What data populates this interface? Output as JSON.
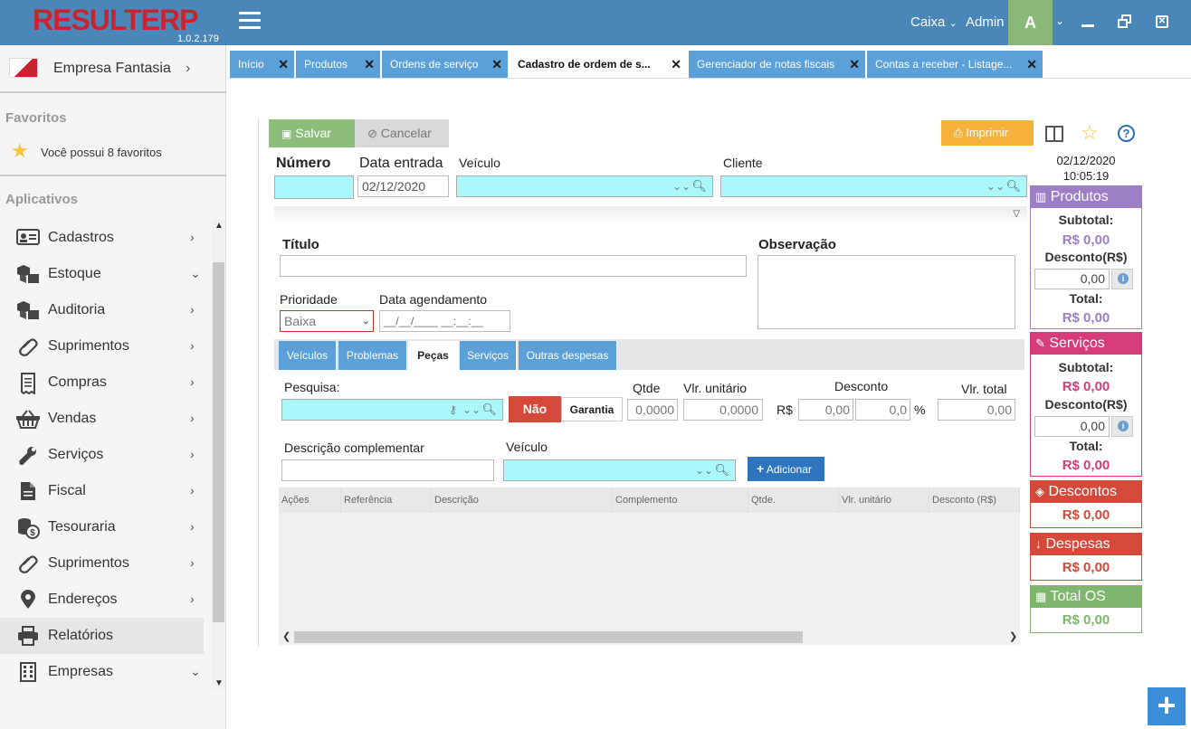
{
  "app": {
    "logo_text": "RESULTERP",
    "version": "1.0.2.179",
    "caixa_label": "Caixa",
    "admin_label": "Admin",
    "avatar_letter": "A"
  },
  "sidebar": {
    "company": "Empresa Fantasia",
    "favorites_heading": "Favoritos",
    "favorites_text": "Você possui 8 favoritos",
    "apps_heading": "Aplicativos",
    "items": [
      {
        "label": "Cadastros",
        "icon": "id-card-icon",
        "chev": "›"
      },
      {
        "label": "Estoque",
        "icon": "boxes-icon",
        "chev": "⌄"
      },
      {
        "label": "Auditoria",
        "icon": "boxes-icon",
        "chev": "›"
      },
      {
        "label": "Suprimentos",
        "icon": "paperclip-icon",
        "chev": "›"
      },
      {
        "label": "Compras",
        "icon": "receipt-icon",
        "chev": "›"
      },
      {
        "label": "Vendas",
        "icon": "basket-icon",
        "chev": "›"
      },
      {
        "label": "Serviços",
        "icon": "wrench-icon",
        "chev": "›"
      },
      {
        "label": "Fiscal",
        "icon": "document-icon",
        "chev": "›"
      },
      {
        "label": "Tesouraria",
        "icon": "coins-icon",
        "chev": "›"
      },
      {
        "label": "Suprimentos",
        "icon": "paperclip-icon",
        "chev": "›"
      },
      {
        "label": "Endereços",
        "icon": "map-pin-icon",
        "chev": "›"
      },
      {
        "label": "Relatórios",
        "icon": "printer-icon",
        "chev": ""
      },
      {
        "label": "Empresas",
        "icon": "building-icon",
        "chev": "⌄"
      }
    ]
  },
  "tabs": [
    {
      "label": "Início"
    },
    {
      "label": "Produtos"
    },
    {
      "label": "Ordens de serviço"
    },
    {
      "label": "Cadastro de ordem de s..."
    },
    {
      "label": "Gerenciador de notas fiscais"
    },
    {
      "label": "Contas a receber - Listage..."
    }
  ],
  "toolbar": {
    "save": "Salvar",
    "cancel": "Cancelar",
    "print": "Imprimir",
    "date": "02/12/2020",
    "time": "10:05:19"
  },
  "form": {
    "numero_label": "Número",
    "data_entrada_label": "Data entrada",
    "data_entrada_value": "02/12/2020",
    "veiculo_label": "Veículo",
    "cliente_label": "Cliente",
    "titulo_label": "Título",
    "observacao_label": "Observação",
    "prioridade_label": "Prioridade",
    "prioridade_value": "Baixa",
    "agendamento_label": "Data agendamento",
    "agendamento_placeholder": "__/__/____ __:__:__"
  },
  "subtabs": [
    {
      "label": "Veículos"
    },
    {
      "label": "Problemas"
    },
    {
      "label": "Peças"
    },
    {
      "label": "Serviços"
    },
    {
      "label": "Outras despesas"
    }
  ],
  "pecas": {
    "pesquisa_label": "Pesquisa:",
    "nao_label": "Não",
    "garantia_label": "Garantia",
    "qtde_label": "Qtde",
    "qtde_value": "0,0000",
    "vlr_unit_label": "Vlr. unitário",
    "vlr_unit_value": "0,0000",
    "desconto_label": "Desconto",
    "rs_prefix": "R$",
    "desconto_rs_value": "0,00",
    "desconto_pct_value": "0,0",
    "pct_suffix": "%",
    "vlr_total_label": "Vlr. total",
    "vlr_total_value": "0,00",
    "desc_comp_label": "Descrição complementar",
    "veiculo_label": "Veículo",
    "adicionar_label": "Adicionar",
    "columns": [
      "Ações",
      "Referência",
      "Descrição",
      "Complemento",
      "Qtde.",
      "Vlr. unitário",
      "Desconto (R$)"
    ]
  },
  "summary": {
    "produtos": {
      "title": "Produtos",
      "subtotal_label": "Subtotal:",
      "subtotal": "R$ 0,00",
      "desconto_label": "Desconto(R$)",
      "desconto_value": "0,00",
      "total_label": "Total:",
      "total": "R$ 0,00",
      "color": "#9c7fc4"
    },
    "servicos": {
      "title": "Serviços",
      "subtotal_label": "Subtotal:",
      "subtotal": "R$ 0,00",
      "desconto_label": "Desconto(R$)",
      "desconto_value": "0,00",
      "total_label": "Total:",
      "total": "R$ 0,00",
      "color": "#d63c7a"
    },
    "descontos": {
      "title": "Descontos",
      "value": "R$ 0,00",
      "color": "#d5493a"
    },
    "despesas": {
      "title": "Despesas",
      "value": "R$ 0,00",
      "color": "#d5493a"
    },
    "total_os": {
      "title": "Total OS",
      "value": "R$ 0,00",
      "color": "#7fb66e"
    }
  },
  "fab": {
    "label": "+"
  }
}
